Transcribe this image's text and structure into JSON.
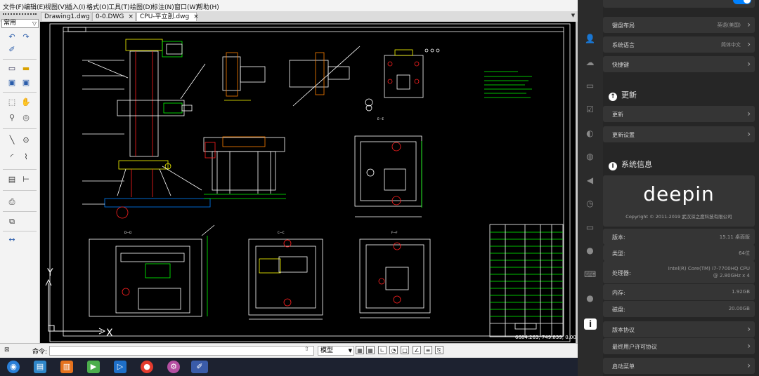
{
  "cad": {
    "menu": [
      "文件(F)",
      "编辑(E)",
      "视图(V)",
      "插入(I)",
      "格式(O)",
      "工具(T)",
      "绘图(D)",
      "标注(N)",
      "窗口(W)",
      "帮助(H)"
    ],
    "tabs": [
      {
        "label": "Drawing1.dwg",
        "close": "×"
      },
      {
        "label": "0-0.DWG",
        "close": "×"
      },
      {
        "label": "CPU-平立剖.dwg",
        "close": "×"
      }
    ],
    "workspace": "常用",
    "axis_x": "X",
    "axis_y": "Y",
    "coords": "6684.263, 749.839, 0.000",
    "command_label": "命令:",
    "model_label": "模型"
  },
  "drawing_notes": {
    "views": [
      "D—D",
      "C—C",
      "E—E",
      "F—F"
    ],
    "title": "CPU-平立剖"
  },
  "settings": {
    "items_top": [
      {
        "label": "键盘布局",
        "value": "英语(美国)"
      },
      {
        "label": "系统语言",
        "value": "简体中文"
      },
      {
        "label": "快捷键",
        "value": ""
      }
    ],
    "update_section": "更新",
    "update_items": [
      {
        "label": "更新"
      },
      {
        "label": "更新设置"
      }
    ],
    "sysinfo_section": "系统信息",
    "logo": "deepin",
    "copyright": "Copyright © 2011-2019 武汉深之度科技有限公司",
    "info": [
      {
        "label": "版本:",
        "value": "15.11 桌面版"
      },
      {
        "label": "类型:",
        "value": "64位"
      },
      {
        "label": "处理器:",
        "value": "Intel(R) Core(TM) i7-7700HQ CPU @ 2.80GHz x 4"
      },
      {
        "label": "内存:",
        "value": "1.92GB"
      },
      {
        "label": "磁盘:",
        "value": "20.00GB"
      }
    ],
    "bottom_items": [
      {
        "label": "版本协议"
      },
      {
        "label": "最终用户许可协议"
      },
      {
        "label": "启动菜单"
      }
    ]
  }
}
